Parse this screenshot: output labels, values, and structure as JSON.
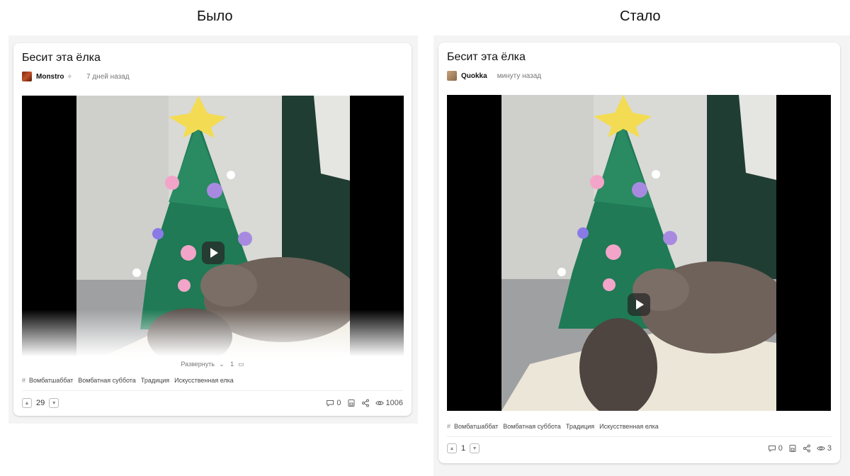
{
  "headings": {
    "before": "Было",
    "after": "Стало"
  },
  "before": {
    "title": "Бесит эта ёлка",
    "author": "Monstro",
    "time": "7 дней назад",
    "expand_label": "Развернуть",
    "media_count": "1",
    "tags": [
      "Вомбатшаббат",
      "Вомбатная суббота",
      "Традиция",
      "Искусственная елка"
    ],
    "rating": "29",
    "comments": "0",
    "views": "1006"
  },
  "after": {
    "title": "Бесит эта ёлка",
    "author": "Quokka",
    "time": "минуту назад",
    "tags": [
      "Вомбатшаббат",
      "Вомбатная суббота",
      "Традиция",
      "Искусственная елка"
    ],
    "rating": "1",
    "comments": "0",
    "views": "3"
  }
}
